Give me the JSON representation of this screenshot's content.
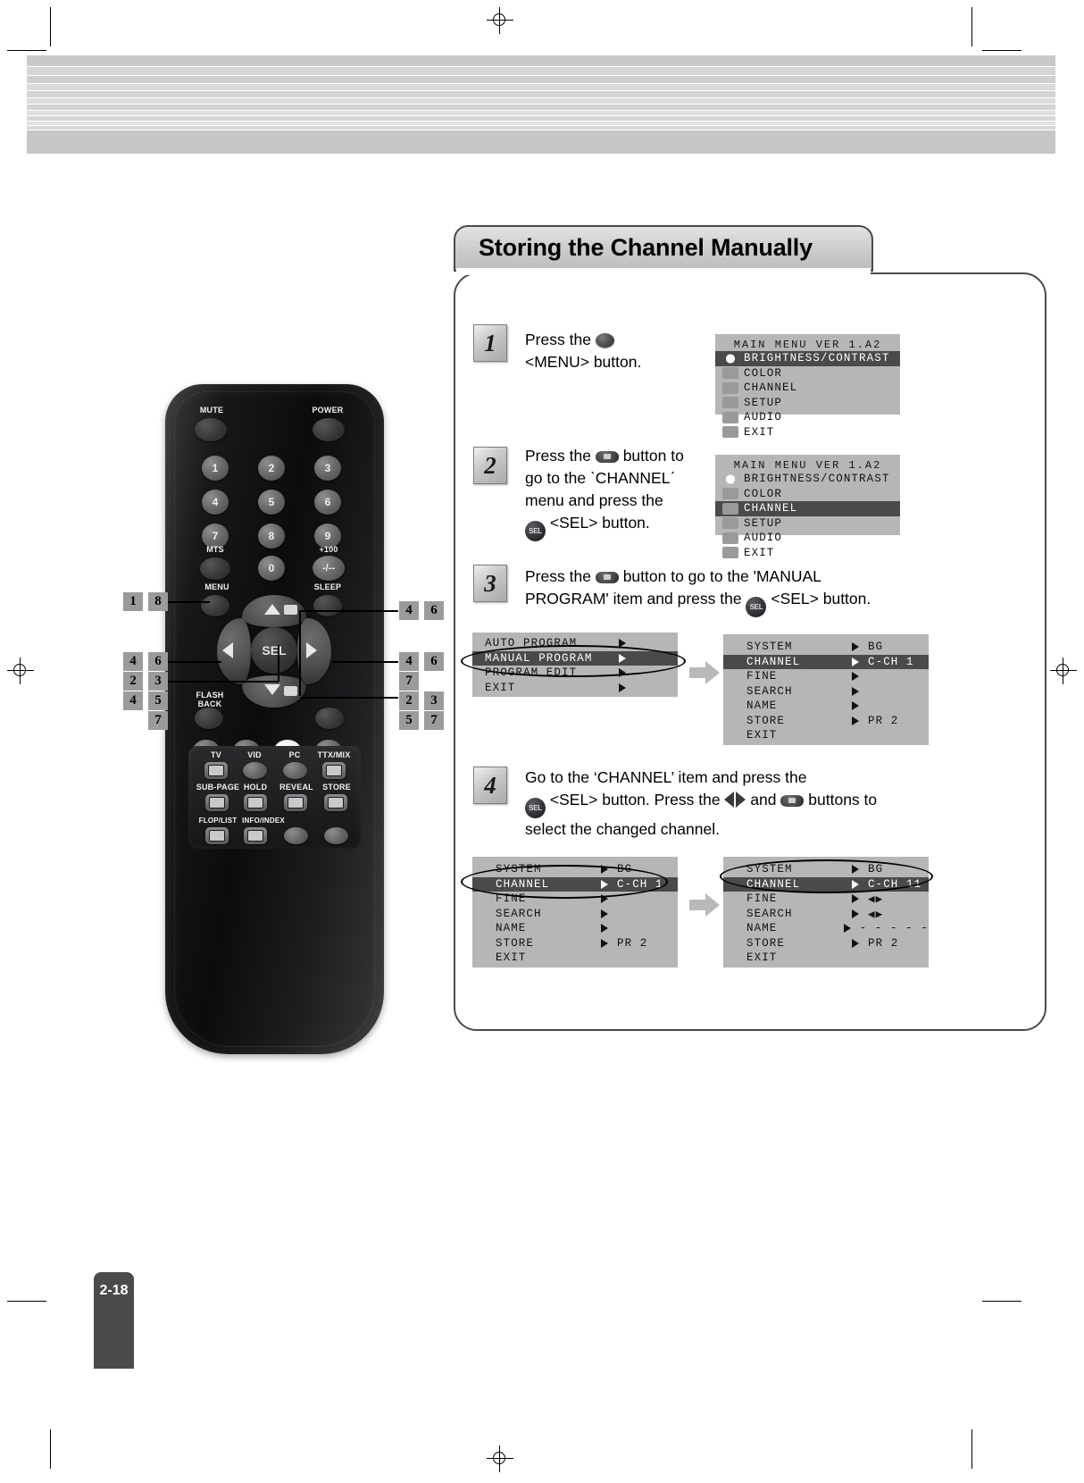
{
  "page": {
    "number": "2-18"
  },
  "section": {
    "title": "Storing the Channel Manually"
  },
  "steps": [
    {
      "num": "1",
      "lines": [
        "Press the ",
        "<MENU> button."
      ]
    },
    {
      "num": "2",
      "lines": [
        "Press the ",
        " button to",
        "go to the  ˋCHANNELˊ",
        "menu and press the",
        " <SEL> button."
      ]
    },
    {
      "num": "3",
      "lines": [
        "Press the ",
        " button to go to the 'MANUAL",
        "PROGRAM' item and press the ",
        " <SEL> button."
      ]
    },
    {
      "num": "4",
      "lines": [
        "Go to the ‘CHANNEL’ item and press the",
        " <SEL> button. Press the ",
        " and ",
        " buttons to",
        "select the changed channel."
      ]
    }
  ],
  "step_text": {
    "s1_a": "Press the",
    "s1_b": "<MENU> button.",
    "s2_a": "Press the",
    "s2_b": "button to",
    "s2_c": "go to the  ˋCHANNELˊ",
    "s2_d": "menu and press the",
    "s2_e": "<SEL> button.",
    "s3_a": "Press the",
    "s3_b": "button to go to the 'MANUAL",
    "s3_c": "PROGRAM' item and press the",
    "s3_d": "<SEL> button.",
    "s4_a": "Go to the ‘CHANNEL’ item and press the",
    "s4_b": "<SEL> button. Press the",
    "s4_c": "and",
    "s4_d": "buttons to",
    "s4_e": "select the changed channel."
  },
  "osd": {
    "main_menu_1": {
      "header": "MAIN MENU      VER  1.A2",
      "items": [
        {
          "label": "BRIGHTNESS/CONTRAST",
          "selected": true,
          "icon": "brightness-icon"
        },
        {
          "label": "COLOR",
          "selected": false,
          "icon": "color-icon"
        },
        {
          "label": "CHANNEL",
          "selected": false,
          "icon": "channel-icon"
        },
        {
          "label": "SETUP",
          "selected": false,
          "icon": "setup-icon"
        },
        {
          "label": "AUDIO",
          "selected": false,
          "icon": "audio-icon"
        },
        {
          "label": "EXIT",
          "selected": false,
          "icon": "exit-icon"
        }
      ]
    },
    "main_menu_2": {
      "header": "MAIN MENU      VER  1.A2",
      "items": [
        {
          "label": "BRIGHTNESS/CONTRAST",
          "selected": false,
          "icon": "brightness-icon"
        },
        {
          "label": "COLOR",
          "selected": false,
          "icon": "color-icon"
        },
        {
          "label": "CHANNEL",
          "selected": true,
          "icon": "channel-icon"
        },
        {
          "label": "SETUP",
          "selected": false,
          "icon": "setup-icon"
        },
        {
          "label": "AUDIO",
          "selected": false,
          "icon": "audio-icon"
        },
        {
          "label": "EXIT",
          "selected": false,
          "icon": "exit-icon"
        }
      ]
    },
    "channel_menu": {
      "items": [
        {
          "label": "AUTO PROGRAM",
          "selected": false
        },
        {
          "label": "MANUAL PROGRAM",
          "selected": true
        },
        {
          "label": "PROGRAM EDIT",
          "selected": false
        },
        {
          "label": "EXIT",
          "selected": false,
          "noarrow": false
        }
      ]
    },
    "manual_program_a": {
      "rows": [
        {
          "label": "SYSTEM",
          "value": "BG",
          "selected": false,
          "arrow": true
        },
        {
          "label": "CHANNEL",
          "value": "C-CH 1",
          "selected": true,
          "arrow": true
        },
        {
          "label": "FINE",
          "value": "",
          "selected": false,
          "arrow": true
        },
        {
          "label": "SEARCH",
          "value": "",
          "selected": false,
          "arrow": true
        },
        {
          "label": "NAME",
          "value": "",
          "selected": false,
          "arrow": true
        },
        {
          "label": "STORE",
          "value": "PR 2",
          "selected": false,
          "arrow": true
        },
        {
          "label": "EXIT",
          "value": "",
          "selected": false,
          "arrow": false
        }
      ]
    },
    "manual_program_b": {
      "rows": [
        {
          "label": "SYSTEM",
          "value": "BG",
          "selected": false,
          "arrow": true
        },
        {
          "label": "CHANNEL",
          "value": "C-CH 1",
          "selected": true,
          "arrow": true
        },
        {
          "label": "FINE",
          "value": "",
          "selected": false,
          "arrow": true
        },
        {
          "label": "SEARCH",
          "value": "",
          "selected": false,
          "arrow": true
        },
        {
          "label": "NAME",
          "value": "",
          "selected": false,
          "arrow": true
        },
        {
          "label": "STORE",
          "value": "PR 2",
          "selected": false,
          "arrow": true
        },
        {
          "label": "EXIT",
          "value": "",
          "selected": false,
          "arrow": false
        }
      ]
    },
    "manual_program_c": {
      "rows": [
        {
          "label": "SYSTEM",
          "value": "BG",
          "selected": false,
          "arrow": true
        },
        {
          "label": "CHANNEL",
          "value": "C-CH 11",
          "selected": true,
          "arrow": true
        },
        {
          "label": "FINE",
          "value": "◀▶",
          "selected": false,
          "arrow": true
        },
        {
          "label": "SEARCH",
          "value": "◀▶",
          "selected": false,
          "arrow": true
        },
        {
          "label": "NAME",
          "value": "- - - - -",
          "selected": false,
          "arrow": true
        },
        {
          "label": "STORE",
          "value": "PR 2",
          "selected": false,
          "arrow": true
        },
        {
          "label": "EXIT",
          "value": "",
          "selected": false,
          "arrow": false
        }
      ]
    }
  },
  "remote": {
    "labels": {
      "mute": "MUTE",
      "power": "POWER",
      "mts": "MTS",
      "plus100": "+100",
      "menu": "MENU",
      "sleep": "SLEEP",
      "minus": "-/--",
      "flash": "FLASH",
      "back": "BACK",
      "sel": "SEL",
      "tv": "TV",
      "vid": "VID",
      "pc": "PC",
      "ttxmix": "TTX/MIX",
      "subpage": "SUB-PAGE",
      "hold": "HOLD",
      "reveal": "REVEAL",
      "store": "STORE",
      "floplist": "FLOP/LIST",
      "infoindex": "INFO/INDEX"
    },
    "keypad": [
      "1",
      "2",
      "3",
      "4",
      "5",
      "6",
      "7",
      "8",
      "9",
      "0"
    ],
    "callouts": {
      "menu": [
        "1",
        "8"
      ],
      "left": [
        "4",
        "6",
        "7"
      ],
      "sel": [
        "2",
        "3"
      ],
      "down": [
        "4",
        "5",
        "7"
      ],
      "up": [
        "4",
        "6"
      ],
      "right": [
        "4",
        "6",
        "7"
      ],
      "flash_right": [
        "2",
        "3"
      ],
      "down_right": [
        "5",
        "7"
      ]
    }
  }
}
